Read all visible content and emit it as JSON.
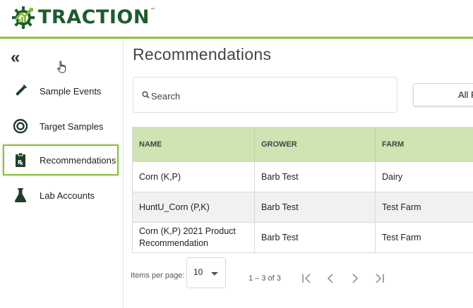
{
  "app": {
    "brand": "TRACTION",
    "trademark": "™"
  },
  "sidebar": {
    "collapse_icon": "double-chevron-left-icon",
    "items": [
      {
        "label": "Sample Events",
        "icon": "test-tube-icon",
        "active": false
      },
      {
        "label": "Target Samples",
        "icon": "target-icon",
        "active": false
      },
      {
        "label": "Recommendations",
        "icon": "clipboard-rx-icon",
        "active": true
      },
      {
        "label": "Lab Accounts",
        "icon": "flask-icon",
        "active": false
      }
    ]
  },
  "main": {
    "title": "Recommendations",
    "search": {
      "placeholder": "Search",
      "value": ""
    },
    "filter_button_label": "All F"
  },
  "table": {
    "columns": [
      "NAME",
      "GROWER",
      "FARM"
    ],
    "rows": [
      [
        "Corn (K,P)",
        "Barb Test",
        "Dairy"
      ],
      [
        "HuntU_Corn (P,K)",
        "Barb Test",
        "Test Farm"
      ],
      [
        "Corn (K,P) 2021 Product Recommendation",
        "Barb Test",
        "Test Farm"
      ]
    ]
  },
  "paginator": {
    "items_per_page_label": "Items per page:",
    "page_size": "10",
    "range_label": "1 – 3 of 3"
  },
  "colors": {
    "brand_green": "#1f5b2e",
    "accent_green": "#8cbf3f",
    "header_row": "#cfe3b3"
  }
}
